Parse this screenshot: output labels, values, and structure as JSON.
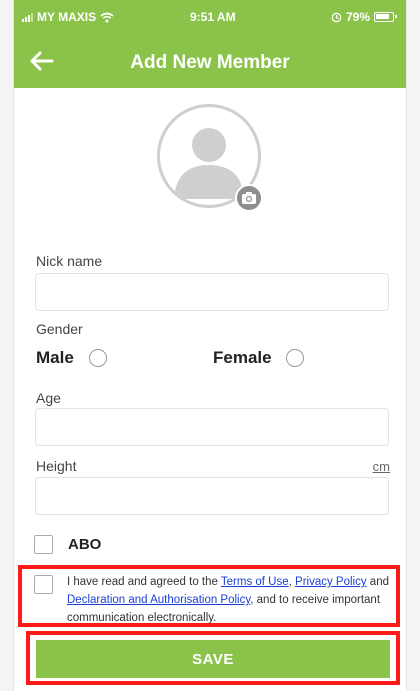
{
  "status_bar": {
    "carrier": "MY MAXIS",
    "time": "9:51 AM",
    "battery": "79%"
  },
  "header": {
    "title": "Add New Member"
  },
  "form": {
    "nickname_label": "Nick name",
    "nickname_value": "",
    "gender_label": "Gender",
    "gender_options": [
      "Male",
      "Female"
    ],
    "age_label": "Age",
    "age_value": "",
    "height_label": "Height",
    "height_unit": "cm",
    "height_value": "",
    "abo_label": "ABO"
  },
  "consent": {
    "prefix": "I have read and agreed to the ",
    "terms_link": "Terms of Use",
    "sep1": ", ",
    "privacy_link": "Privacy Policy",
    "sep2": " and ",
    "declaration_link": "Declaration and Authorisation Policy",
    "suffix": ", and to receive important communication electronically."
  },
  "actions": {
    "save_label": "SAVE"
  },
  "colors": {
    "brand_green": "#8bc34a",
    "highlight_red": "#ff1a1a",
    "link_blue": "#1a3fd6"
  },
  "icons": [
    "wifi-icon",
    "alarm-icon",
    "battery-icon",
    "back-arrow-icon",
    "avatar-icon",
    "camera-icon"
  ]
}
